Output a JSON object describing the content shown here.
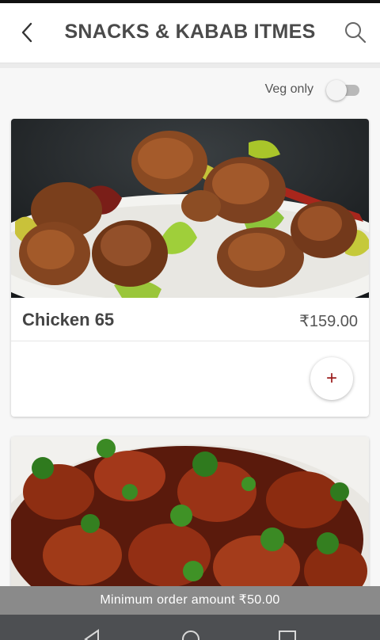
{
  "header": {
    "title": "SNACKS & KABAB ITMES",
    "back_icon": "chevron-left-icon",
    "search_icon": "search-icon"
  },
  "filter": {
    "veg_only_label": "Veg only",
    "veg_only_enabled": false
  },
  "items": [
    {
      "name": "Chicken 65",
      "price": "₹159.00",
      "add_label": "+"
    },
    {
      "name": "",
      "price": "",
      "add_label": "+"
    }
  ],
  "footer": {
    "minimum_order": "Minimum order amount ₹50.00"
  },
  "navigation": {
    "icons": [
      "back-triangle-icon",
      "home-circle-icon",
      "recents-square-icon"
    ]
  },
  "colors": {
    "accent": "#9b1b1b",
    "title_text": "#4a4a4a",
    "min_bar": "#8a8a8a",
    "nav_bar": "#4d4f52"
  }
}
